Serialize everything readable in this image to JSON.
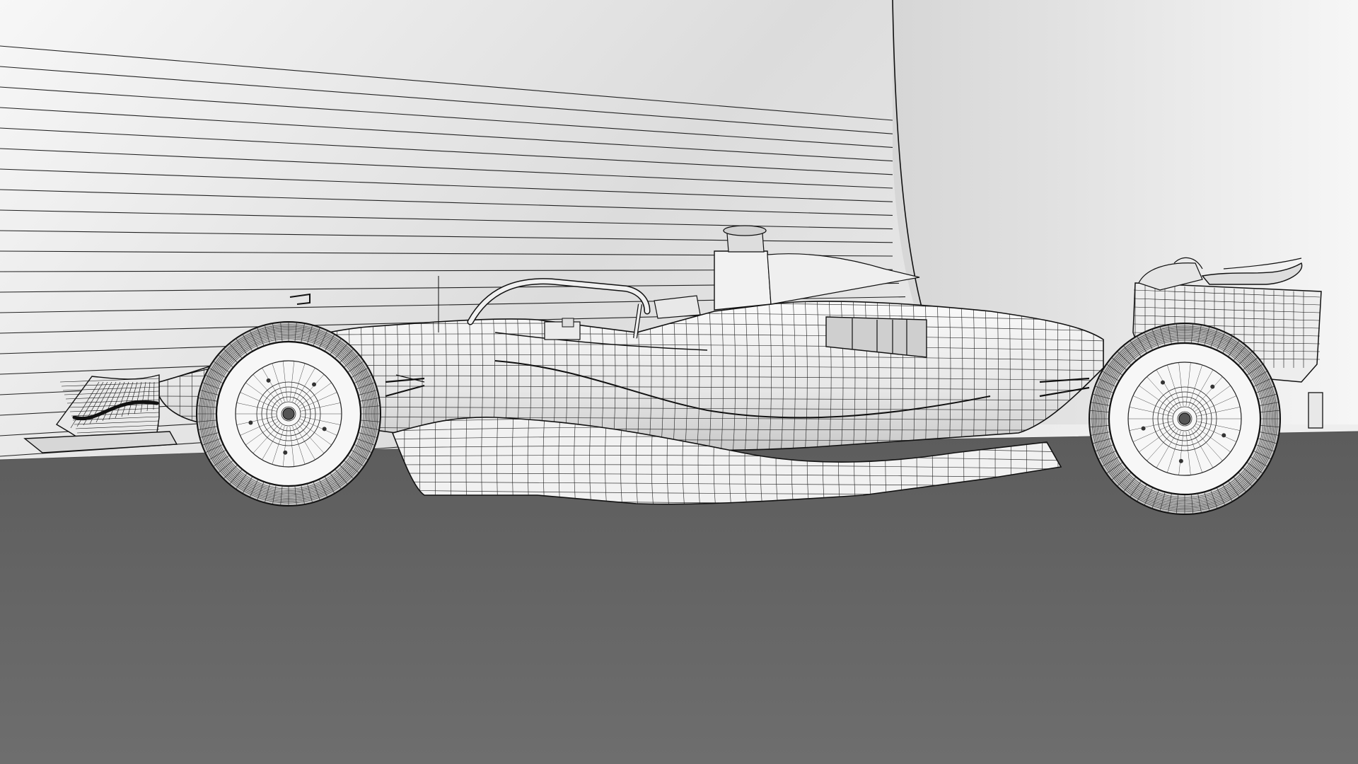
{
  "scene": {
    "subject": "formula-one-car-wireframe",
    "view": "side-profile",
    "colors": {
      "backdrop_light": "#f4f4f4",
      "backdrop_mid": "#d9d9d9",
      "floor": "#6b6b6b",
      "floor_dark": "#595959",
      "wire": "#1a1a1a",
      "body_fill": "#f2f2f2",
      "shadow_fill": "#cfcfcf"
    }
  }
}
